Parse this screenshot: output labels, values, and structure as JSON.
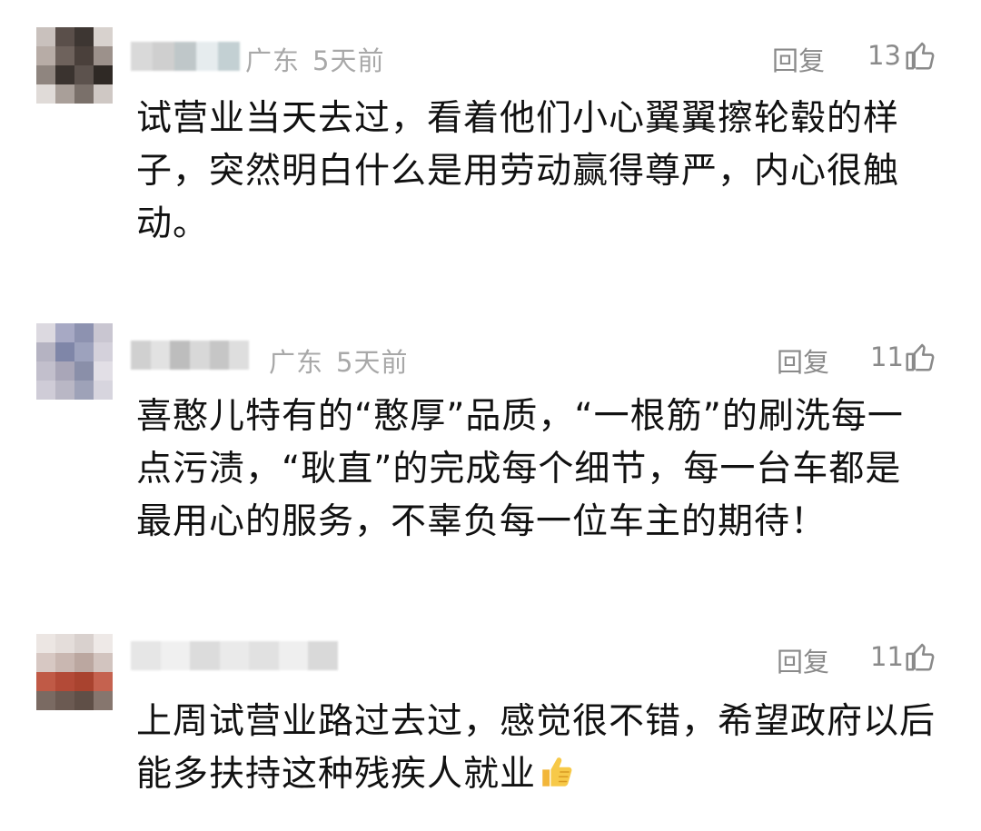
{
  "comments": [
    {
      "location": "广东",
      "time": "5天前",
      "reply_label": "回复",
      "likes": "13",
      "text": "试营业当天去过，看着他们小心翼翼擦轮毂的样子，突然明白什么是用劳动赢得尊严，内心很触动。",
      "avatar_colors": [
        "#c9c1bd",
        "#5a4f4a",
        "#3d3632",
        "#d8d2ce",
        "#b7aca6",
        "#6e625c",
        "#4a403b",
        "#9c918b",
        "#8f857f",
        "#3a332f",
        "#5c524d",
        "#2f2925",
        "#e0dbd8",
        "#a99f99",
        "#7a706a",
        "#cfc8c4"
      ],
      "name_colors": [
        "#d9d9d9",
        "#cfcfcf",
        "#bfc7c9",
        "#e6ecee",
        "#c3d0d3"
      ]
    },
    {
      "location": "广东",
      "time": "5天前",
      "reply_label": "回复",
      "likes": "11",
      "text": "喜憨儿特有的“憨厚”品质，“一根筋”的刷洗每一点污渍，“耿直”的完成每个细节，每一台车都是最用心的服务，不辜负每一位车主的期待！",
      "avatar_colors": [
        "#dcd9e0",
        "#a7a9c4",
        "#8d92b0",
        "#c9c6d1",
        "#b5b3c2",
        "#7f86a8",
        "#9da2bd",
        "#d4d1db",
        "#c2bfcc",
        "#a9a6b8",
        "#8a8fa9",
        "#e2dfe6",
        "#cfccd7",
        "#b9b7c5",
        "#9ea2b8",
        "#d7d5de"
      ],
      "name_colors": [
        "#d0d0d0",
        "#e2e2e2",
        "#bdbdbd",
        "#d8d8d8",
        "#c6c6c6",
        "#dedede"
      ]
    },
    {
      "location": "",
      "time": "",
      "reply_label": "回复",
      "likes": "11",
      "text": "上周试营业路过去过，感觉很不错，希望政府以后能多扶持这种残疾人就业",
      "emoji": "thumbs-up-emoji",
      "avatar_colors": [
        "#ece6e3",
        "#e4ddda",
        "#d9d1ce",
        "#eee9e7",
        "#d7c8c3",
        "#c9b7b1",
        "#bba7a0",
        "#d2c4bf",
        "#c05a46",
        "#b34a37",
        "#a9432f",
        "#c5624f",
        "#7a6a62",
        "#6b5a52",
        "#5f4f47",
        "#86766e"
      ],
      "name_colors": [
        "#e6e6e6",
        "#f0f0f0",
        "#dcdcdc",
        "#eaeaea",
        "#e1e1e1",
        "#efefef",
        "#d9d9d9"
      ]
    }
  ]
}
